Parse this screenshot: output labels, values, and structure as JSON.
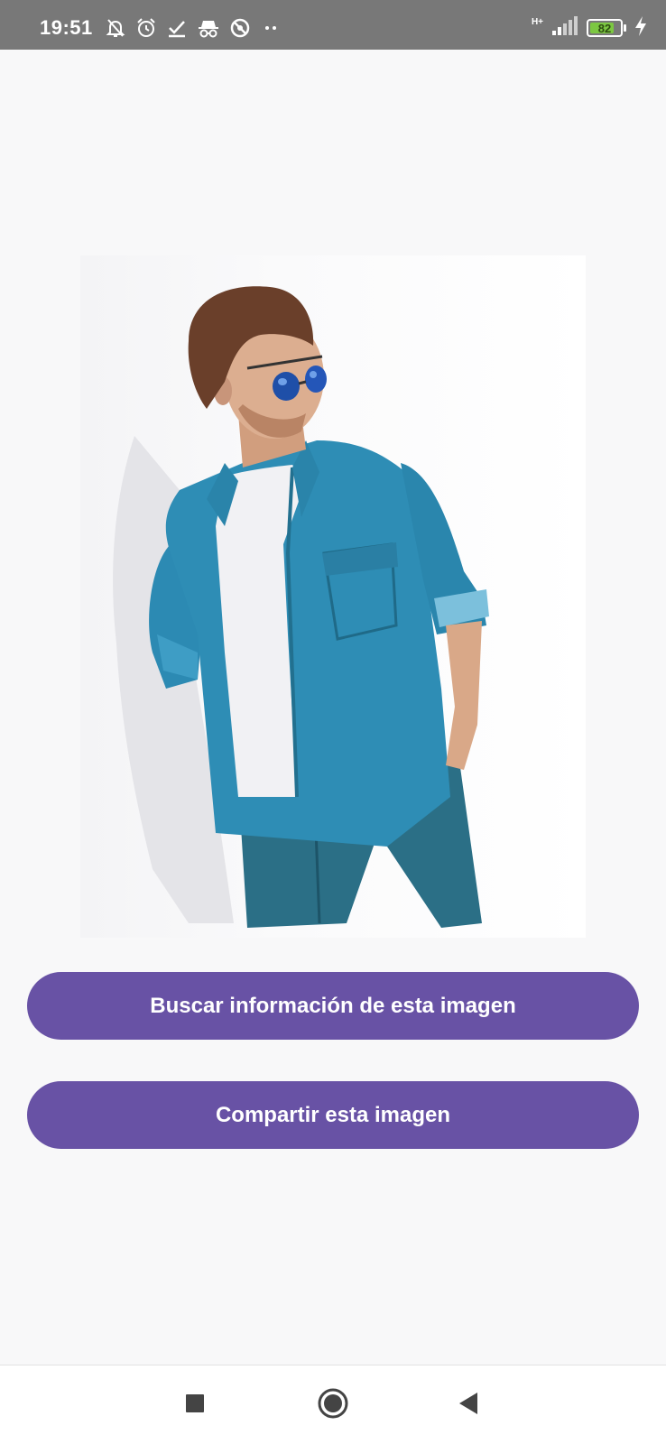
{
  "status_bar": {
    "time": "19:51",
    "network_type": "H+",
    "battery_level": "82",
    "battery_fraction": 0.82,
    "charging": true,
    "colors": {
      "background": "#787878",
      "battery_fill": "#7cc742"
    },
    "icons_left": [
      "bell-off-icon",
      "alarm-icon",
      "check-download-icon",
      "incognito-icon",
      "no-disturb-icon",
      "more-dots-icon"
    ],
    "icons_right": [
      "signal-icon",
      "battery-icon",
      "charging-bolt-icon"
    ]
  },
  "photo": {
    "description_icon": "image-photo"
  },
  "buttons": {
    "search_label": "Buscar información de esta imagen",
    "share_label": "Compartir esta imagen",
    "color": "#6852a5"
  },
  "nav_bar": {
    "icons": [
      "recents-square-icon",
      "home-circle-icon",
      "back-triangle-icon"
    ]
  }
}
